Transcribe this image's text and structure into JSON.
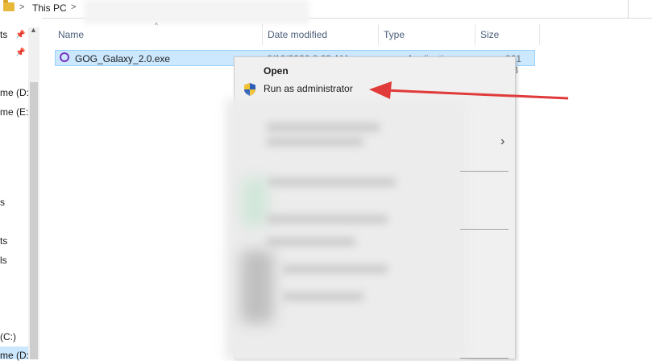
{
  "address_bar": {
    "breadcrumb": "This PC",
    "sep1": ">",
    "sep2": ">"
  },
  "nav": {
    "items": [
      {
        "label": "ts"
      },
      {
        "label": "me (D:"
      },
      {
        "label": "me (E:)"
      },
      {
        "label": "s"
      },
      {
        "label": "ts"
      },
      {
        "label": "ls"
      },
      {
        "label": "(C:)"
      },
      {
        "label": "me (D:"
      }
    ],
    "pin_glyph": "📌",
    "scroll_up": "▲"
  },
  "columns": {
    "name": "Name",
    "date": "Date modified",
    "type": "Type",
    "size": "Size",
    "sort_glyph": "^"
  },
  "file": {
    "name": "GOG_Galaxy_2.0.exe",
    "date": "6/10/2020 8:03 AM",
    "type": "Application",
    "size": "961 KB"
  },
  "context_menu": {
    "open": "Open",
    "run_as_admin": "Run as administrator",
    "submenu_chevron": "›"
  },
  "colors": {
    "selection": "#cce8ff",
    "arrow": "#e03a3a",
    "accent_icon": "#7a2fc0"
  },
  "icons": {
    "file": "gog-galaxy-icon",
    "shield": "uac-shield-icon",
    "folder": "folder-icon"
  }
}
